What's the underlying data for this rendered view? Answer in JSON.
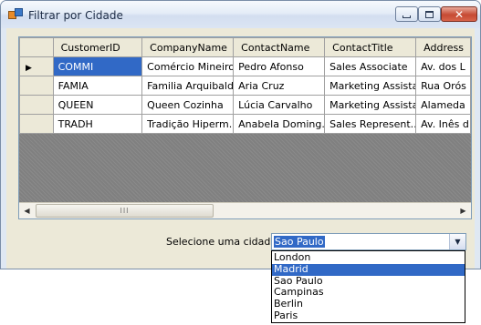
{
  "window": {
    "title": "Filtrar por Cidade"
  },
  "grid": {
    "columns": [
      "CustomerID",
      "CompanyName",
      "ContactName",
      "ContactTitle",
      "Address"
    ],
    "rows": [
      [
        "COMMI",
        "Comércio Mineiro",
        "Pedro Afonso",
        "Sales Associate",
        "Av. dos L"
      ],
      [
        "FAMIA",
        "Familia Arquibaldo",
        "Aria Cruz",
        "Marketing Assistant",
        "Rua Orós"
      ],
      [
        "QUEEN",
        "Queen Cozinha",
        "Lúcia Carvalho",
        "Marketing Assistant",
        "Alameda"
      ],
      [
        "TRADH",
        "Tradição Hiperm...",
        "Anabela Doming...",
        "Sales Represent...",
        "Av. Inês d"
      ]
    ],
    "current_row_indicator": "▶",
    "scroll_thumb_label": "III"
  },
  "city_select": {
    "label": "Selecione uma cidade",
    "value": "Sao Paulo",
    "options": [
      "London",
      "Madrid",
      "Sao Paulo",
      "Campinas",
      "Berlin",
      "Paris"
    ],
    "highlighted": "Madrid"
  },
  "colors": {
    "selection": "#3169c6",
    "grid_empty": "#808080"
  }
}
